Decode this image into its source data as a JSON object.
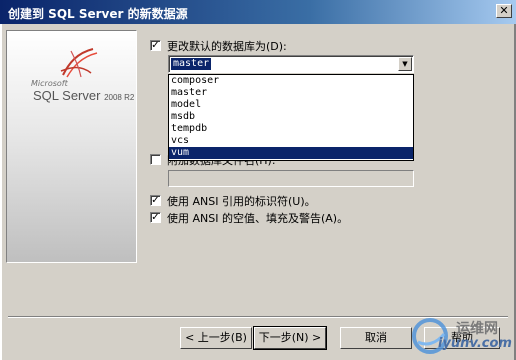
{
  "window": {
    "title": "创建到 SQL Server 的新数据源",
    "close_glyph": "✕"
  },
  "logo": {
    "brand": "Microsoft",
    "product": "SQL Server",
    "version": "2008 R2"
  },
  "options": {
    "change_default_db": {
      "label": "更改默认的数据库为(D):",
      "checked": true
    },
    "attach_db_file": {
      "label": "附加数据库文件名(H):",
      "checked": false
    },
    "ansi_quoted": {
      "label": "使用 ANSI 引用的标识符(U)。",
      "checked": true
    },
    "ansi_nulls": {
      "label": "使用 ANSI 的空值、填充及警告(A)。",
      "checked": true
    }
  },
  "database_combo": {
    "selected": "master",
    "items": [
      "composer",
      "master",
      "model",
      "msdb",
      "tempdb",
      "vcs",
      "vum"
    ],
    "highlighted": "vum"
  },
  "buttons": {
    "back": "< 上一步(B)",
    "next": "下一步(N) >",
    "cancel": "取消",
    "help": "帮助"
  },
  "watermark": {
    "line1": "运维网",
    "line2": "iyunv.com"
  }
}
